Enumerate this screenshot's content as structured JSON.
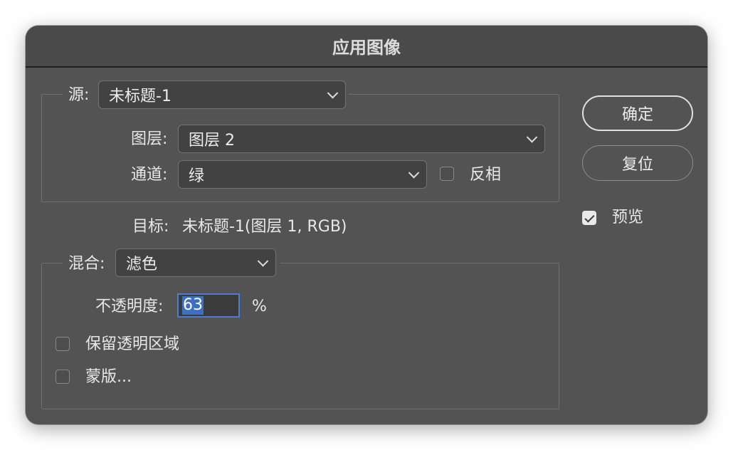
{
  "dialog": {
    "title": "应用图像"
  },
  "source": {
    "label": "源:",
    "value": "未标题-1"
  },
  "layer": {
    "label": "图层:",
    "value": "图层 2"
  },
  "channel": {
    "label": "通道:",
    "value": "绿"
  },
  "invert": {
    "label": "反相",
    "checked": false
  },
  "target": {
    "label": "目标:",
    "value": "未标题-1(图层 1, RGB)"
  },
  "blend": {
    "label": "混合:",
    "value": "滤色"
  },
  "opacity": {
    "label": "不透明度:",
    "value": "63",
    "unit": "%"
  },
  "preserve_transparency": {
    "label": "保留透明区域",
    "checked": false
  },
  "mask": {
    "label": "蒙版...",
    "checked": false
  },
  "buttons": {
    "ok": "确定",
    "reset": "复位"
  },
  "preview": {
    "label": "预览",
    "checked": true
  },
  "colors": {
    "dialog_bg": "#535353",
    "focus_accent": "#4a7ed4",
    "selection": "#3f6fbf"
  }
}
